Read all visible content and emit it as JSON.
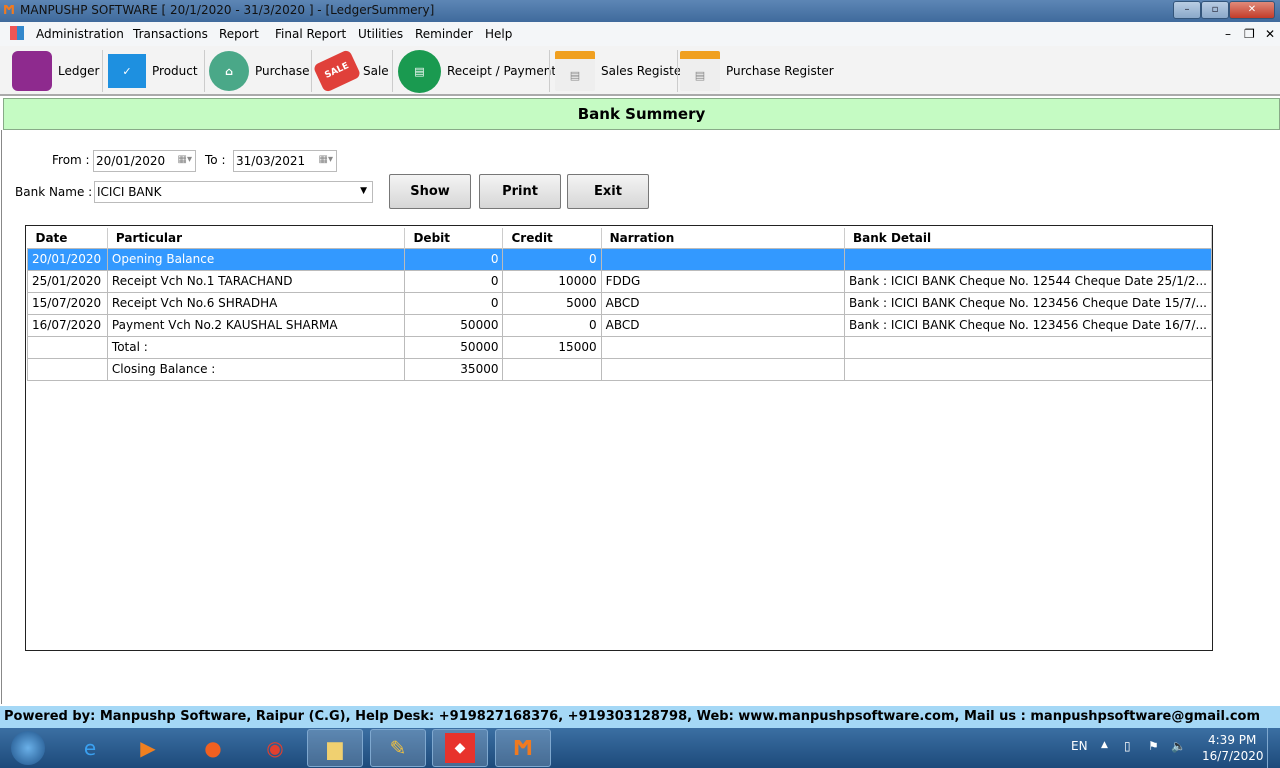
{
  "window": {
    "title": "MANPUSHP SOFTWARE [ 20/1/2020 - 31/3/2020 ]   - [LedgerSummery]",
    "min": "–",
    "max": "▫",
    "close": "✕"
  },
  "menu": [
    "Administration",
    "Transactions",
    "Report",
    "Final Report",
    "Utilities",
    "Reminder",
    "Help"
  ],
  "mdi": {
    "min": "–",
    "restore": "❐",
    "close": "✕"
  },
  "toolbar": [
    {
      "label": "Ledger",
      "icon": "ledger-book-icon",
      "color": "#8e2a8e"
    },
    {
      "label": "Product",
      "icon": "products-icon",
      "color": "#1e90e0"
    },
    {
      "label": "Purchase",
      "icon": "basket-icon",
      "color": "#4aa888"
    },
    {
      "label": "Sale",
      "icon": "sale-tag-icon",
      "color": "#e0403a"
    },
    {
      "label": "Receipt / Payment",
      "icon": "receipt-payment-icon",
      "color": "#1a9a50"
    },
    {
      "label": "Sales Register",
      "icon": "sales-register-icon",
      "color": "#f0a020"
    },
    {
      "label": "Purchase Register",
      "icon": "purchase-register-icon",
      "color": "#f0a020"
    }
  ],
  "header": {
    "title": "Bank Summery"
  },
  "filters": {
    "from_label": "From :",
    "from_value": "20/01/2020",
    "to_label": "To :",
    "to_value": "31/03/2021",
    "bank_label": "Bank Name :",
    "bank_value": "ICICI BANK"
  },
  "buttons": {
    "show": "Show",
    "print": "Print",
    "exit": "Exit"
  },
  "table": {
    "columns": [
      "Date",
      "Particular",
      "Debit",
      "Credit",
      "Narration",
      "Bank Detail"
    ],
    "rows": [
      [
        "20/01/2020",
        "Opening Balance",
        "0",
        "0",
        "",
        ""
      ],
      [
        "25/01/2020",
        "Receipt Vch No.1 TARACHAND",
        "0",
        "10000",
        "FDDG",
        "Bank : ICICI BANK Cheque No. 12544 Cheque Date 25/1/2..."
      ],
      [
        "15/07/2020",
        "Receipt Vch No.6 SHRADHA",
        "0",
        "5000",
        "ABCD",
        "Bank : ICICI BANK Cheque No. 123456 Cheque Date 15/7/..."
      ],
      [
        "16/07/2020",
        "Payment Vch No.2 KAUSHAL SHARMA",
        "50000",
        "0",
        "ABCD",
        "Bank : ICICI BANK Cheque No. 123456 Cheque Date 16/7/..."
      ],
      [
        "",
        "Total :",
        "50000",
        "15000",
        "",
        ""
      ],
      [
        "",
        "Closing Balance :",
        "35000",
        "",
        "",
        ""
      ]
    ],
    "selected_row": 0
  },
  "footer": "Powered by: Manpushp Software, Raipur (C.G), Help Desk: +919827168376, +919303128798, Web: www.manpushpsoftware.com,  Mail us :  manpushpsoftware@gmail.com",
  "taskbar": {
    "lang": "EN",
    "time": "4:39 PM",
    "date": "16/7/2020"
  }
}
